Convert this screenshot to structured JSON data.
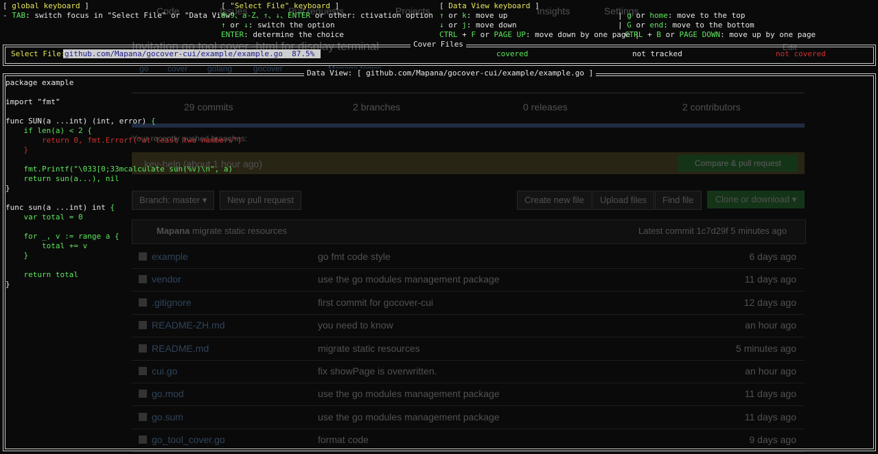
{
  "background": {
    "tabs": [
      "Code",
      "Issues",
      "Pull requests",
      "Projects",
      "Insights",
      "Settings"
    ],
    "repo_title": "Invitation go tool cover -html for display terminal",
    "edit_label": "Edit",
    "topics": [
      "go",
      "cover",
      "golang",
      "gocover",
      "Manage topics"
    ],
    "stats": [
      "29 commits",
      "2 branches",
      "0 releases",
      "2 contributors"
    ],
    "recent_label": "Your recently pushed branches:",
    "banner_text": "key-help (about 1 hour ago)",
    "compare_label": "Compare & pull request",
    "branch_label": "Branch: master ▾",
    "new_pr_label": "New pull request",
    "create_file_label": "Create new file",
    "upload_label": "Upload files",
    "find_file_label": "Find file",
    "clone_label": "Clone or download ▾",
    "commit_author": "Mapana",
    "commit_message": "migrate static resources",
    "commit_latest": "Latest commit 1c7d29f 5 minutes ago",
    "files": [
      {
        "name": "example",
        "message": "go fmt code style",
        "age": "6 days ago"
      },
      {
        "name": "vendor",
        "message": "use the go modules management package",
        "age": "11 days ago"
      },
      {
        "name": ".gitignore",
        "message": "first commit for gocover-cui",
        "age": "12 days ago"
      },
      {
        "name": "README-ZH.md",
        "message": "you need to know",
        "age": "an hour ago"
      },
      {
        "name": "README.md",
        "message": "migrate static resources",
        "age": "5 minutes ago"
      },
      {
        "name": "cui.go",
        "message": "fix showPage is overwritten.",
        "age": "an hour ago"
      },
      {
        "name": "go.mod",
        "message": "use the go modules management package",
        "age": "11 days ago"
      },
      {
        "name": "go.sum",
        "message": "use the go modules management package",
        "age": "11 days ago"
      },
      {
        "name": "go_tool_cover.go",
        "message": "format code",
        "age": "9 days ago"
      }
    ]
  },
  "help": {
    "global": {
      "title": "global keyboard",
      "line1_key": "TAB",
      "line1_text": ": switch focus in \"Select File\" or \"Data View\""
    },
    "select_file": {
      "title": "\"Select File\" keyboard",
      "l1_key": "0-9、a-Z、↑、↓、ENTER",
      "l1_text": " or other: ctivation option",
      "l2_key1": "↑",
      "l2_mid": " or ",
      "l2_key2": "↓",
      "l2_text": ": switch the option",
      "l3_key": "ENTER",
      "l3_text": ": determine the choice"
    },
    "data_view": {
      "title": "Data View keyboard",
      "l1_key1": "↑",
      "l1_mid": " or ",
      "l1_key2": "k",
      "l1_text": ": move up",
      "l2_key1": "↓",
      "l2_mid": " or ",
      "l2_key2": "j",
      "l2_text": ": move down",
      "l3_key1": "CTRL",
      "l3_plus": " + ",
      "l3_key2": "F",
      "l3_or": " or ",
      "l3_key3": "PAGE UP",
      "l3_text": ": move down by one page",
      "r1_key1": "g",
      "r1_or": " or ",
      "r1_key2": "home",
      "r1_text": ": move to the top",
      "r2_key1": "G",
      "r2_or": " or ",
      "r2_key2": "end",
      "r2_text": ": move to the bottom",
      "r3_key1": "CTRL",
      "r3_plus": " + ",
      "r3_key2": "B",
      "r3_or": " or ",
      "r3_key3": "PAGE DOWN",
      "r3_text": ": move up by one page"
    }
  },
  "cover_files": {
    "title": "Cover Files",
    "select_label": "Select File:",
    "selected_path": "github.com/Mapana/gocover-cui/example/example.go  87.5% ",
    "legend_covered": "covered",
    "legend_not_tracked": "not tracked",
    "legend_not_covered": "not covered"
  },
  "data_view": {
    "title": "Data View: [ github.com/Mapana/gocover-cui/example/example.go ]",
    "lines": [
      {
        "text": "package example",
        "cls": "w"
      },
      {
        "text": "",
        "cls": "w"
      },
      {
        "text": "import \"fmt\"",
        "cls": "w"
      },
      {
        "text": "",
        "cls": "w"
      },
      {
        "text": "func SUN(a ...int) (int, error) {",
        "cls": "w",
        "brace_green": true
      },
      {
        "text": "    if len(a) < 2 {",
        "cls": "g"
      },
      {
        "text": "        return 0, fmt.Errorf(\"at least two numbers\")",
        "cls": "r"
      },
      {
        "text": "    }",
        "cls": "r"
      },
      {
        "text": "",
        "cls": "w"
      },
      {
        "text": "    fmt.Printf(\"\\033[0;33mcalculate sun(%v)\\n\", a)",
        "cls": "g"
      },
      {
        "text": "    return sun(a...), nil",
        "cls": "g"
      },
      {
        "text": "}",
        "cls": "w"
      },
      {
        "text": "",
        "cls": "w"
      },
      {
        "text": "func sun(a ...int) int {",
        "cls": "w",
        "brace_green": true
      },
      {
        "text": "    var total = 0",
        "cls": "g"
      },
      {
        "text": "",
        "cls": "w"
      },
      {
        "text": "    for _, v := range a {",
        "cls": "g"
      },
      {
        "text": "        total += v",
        "cls": "g"
      },
      {
        "text": "    }",
        "cls": "g"
      },
      {
        "text": "",
        "cls": "w"
      },
      {
        "text": "    return total",
        "cls": "g"
      },
      {
        "text": "}",
        "cls": "w"
      }
    ]
  },
  "colors": {
    "key_yellow": "#e6e65c",
    "key_green": "#5ee65e",
    "not_covered_red": "#d03030",
    "selection_bg": "#cfcfcf"
  }
}
